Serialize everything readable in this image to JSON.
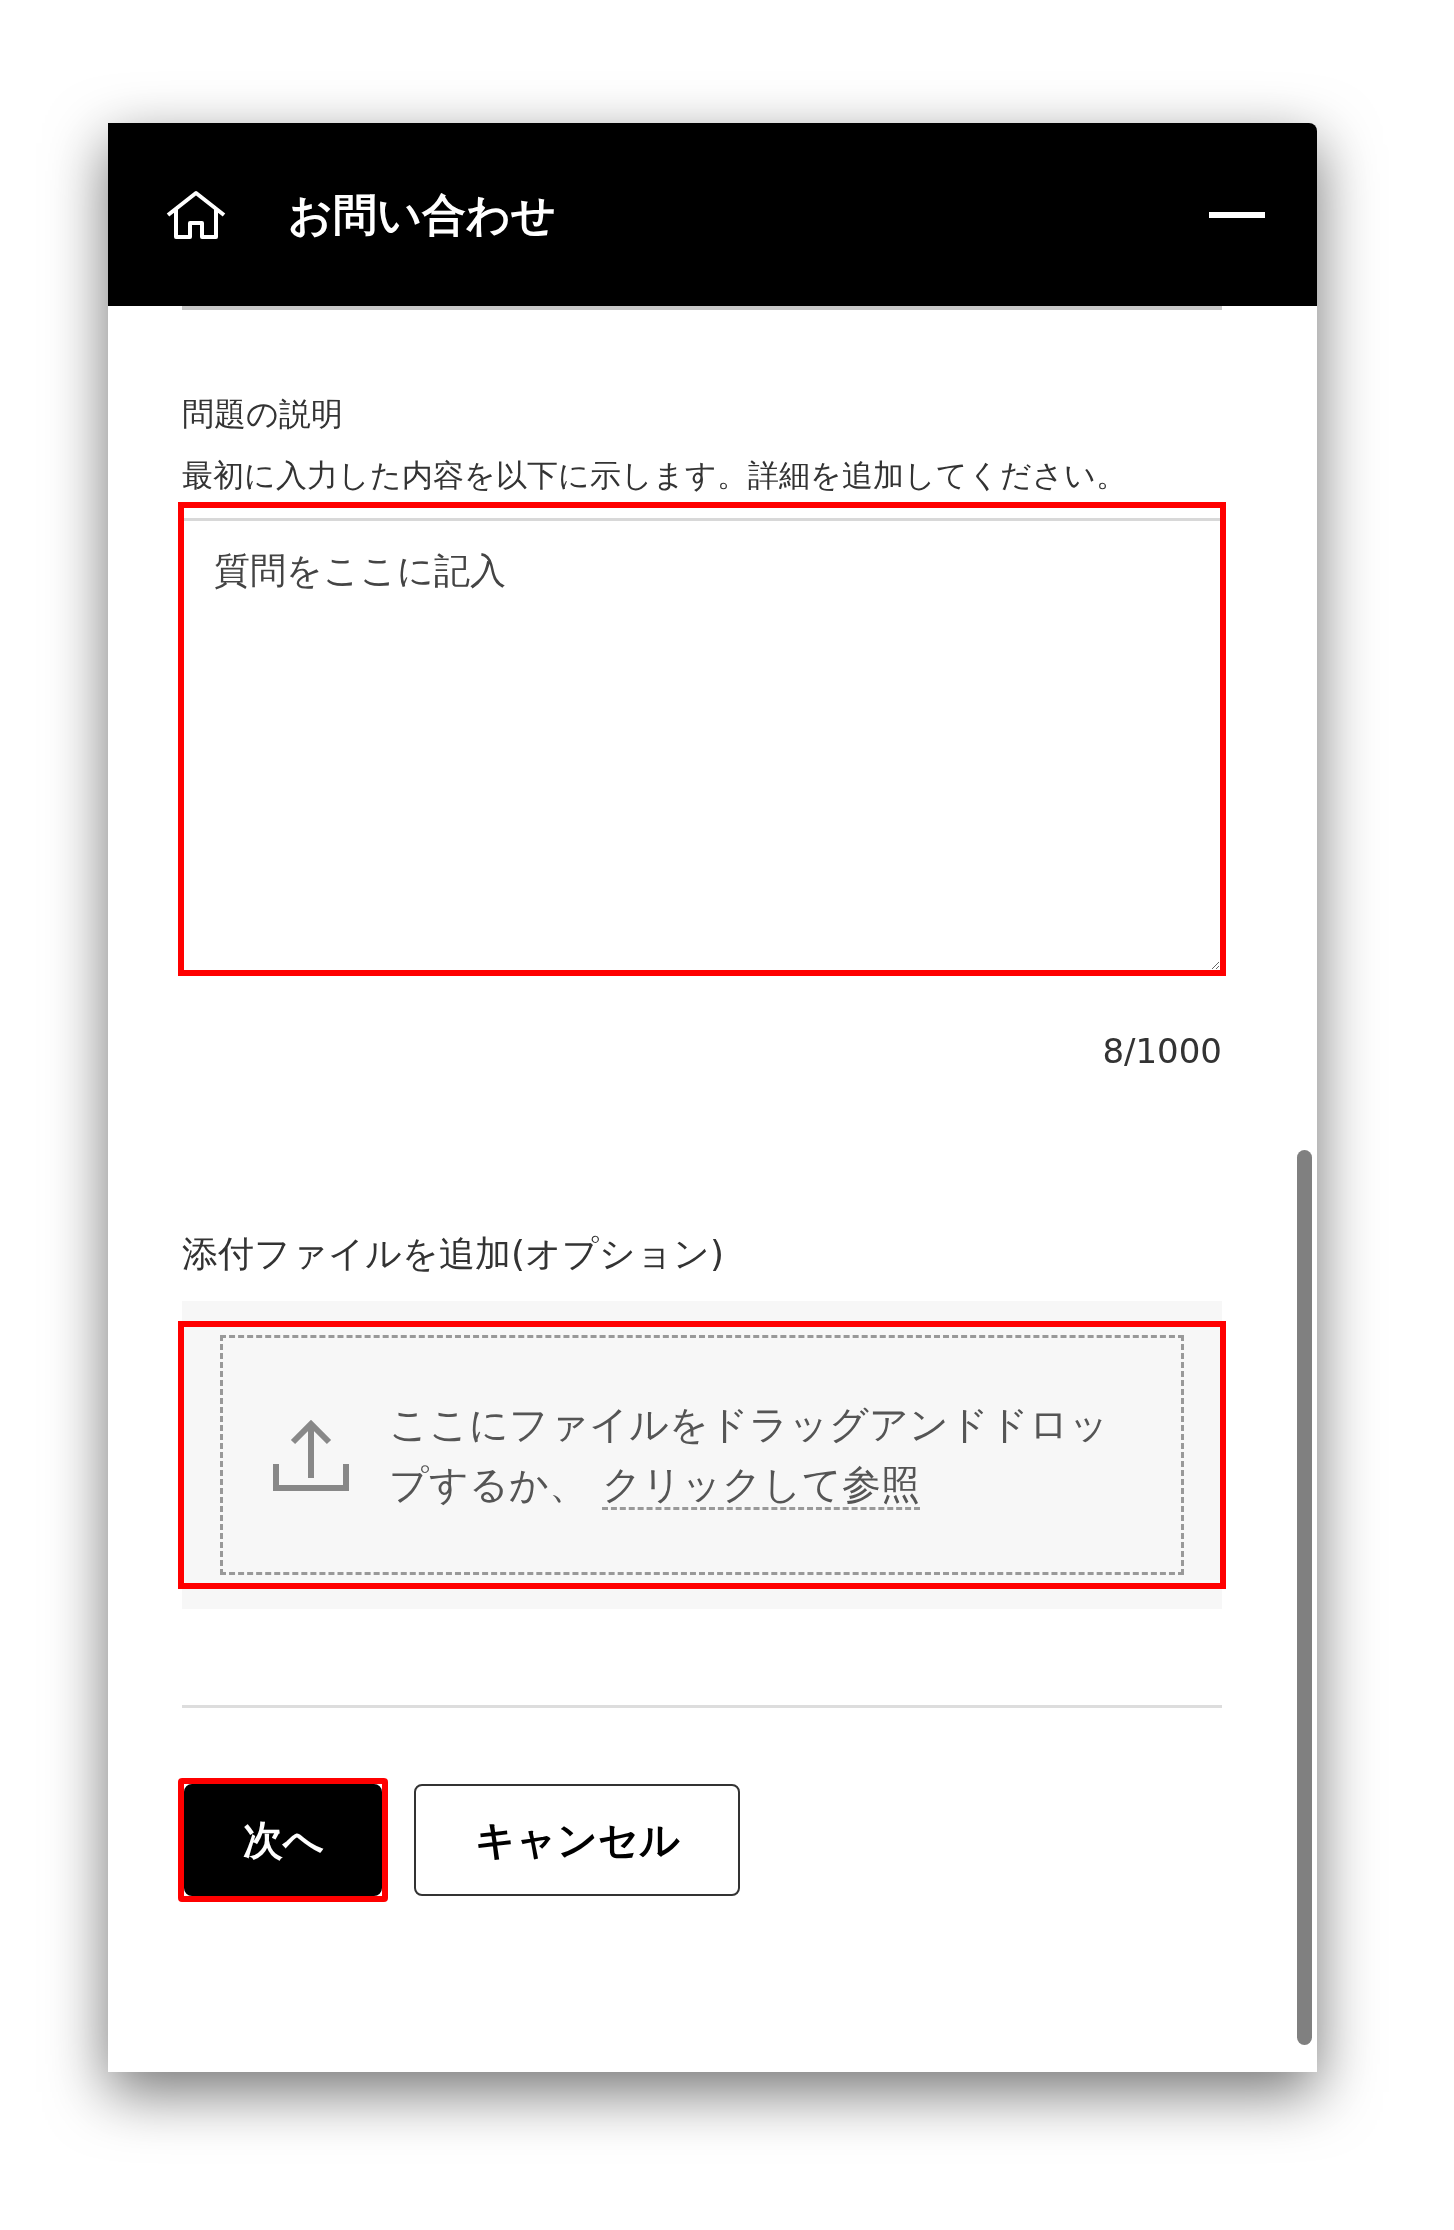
{
  "header": {
    "title": "お問い合わせ"
  },
  "description": {
    "label": "問題の説明",
    "hint": "最初に入力した内容を以下に示します。詳細を追加してください。",
    "value": "質問をここに記入",
    "highlighted": true,
    "counter": "8/1000"
  },
  "attachment": {
    "label": "添付ファイルを追加(オプション)",
    "drop_text": "ここにファイルをドラッグアンドドロップするか、",
    "link": "クリックして参照",
    "highlighted": true
  },
  "buttons": [
    {
      "label": "次へ",
      "kind": "primary",
      "highlighted": true
    },
    {
      "label": "キャンセル",
      "kind": "secondary",
      "highlighted": false
    }
  ]
}
